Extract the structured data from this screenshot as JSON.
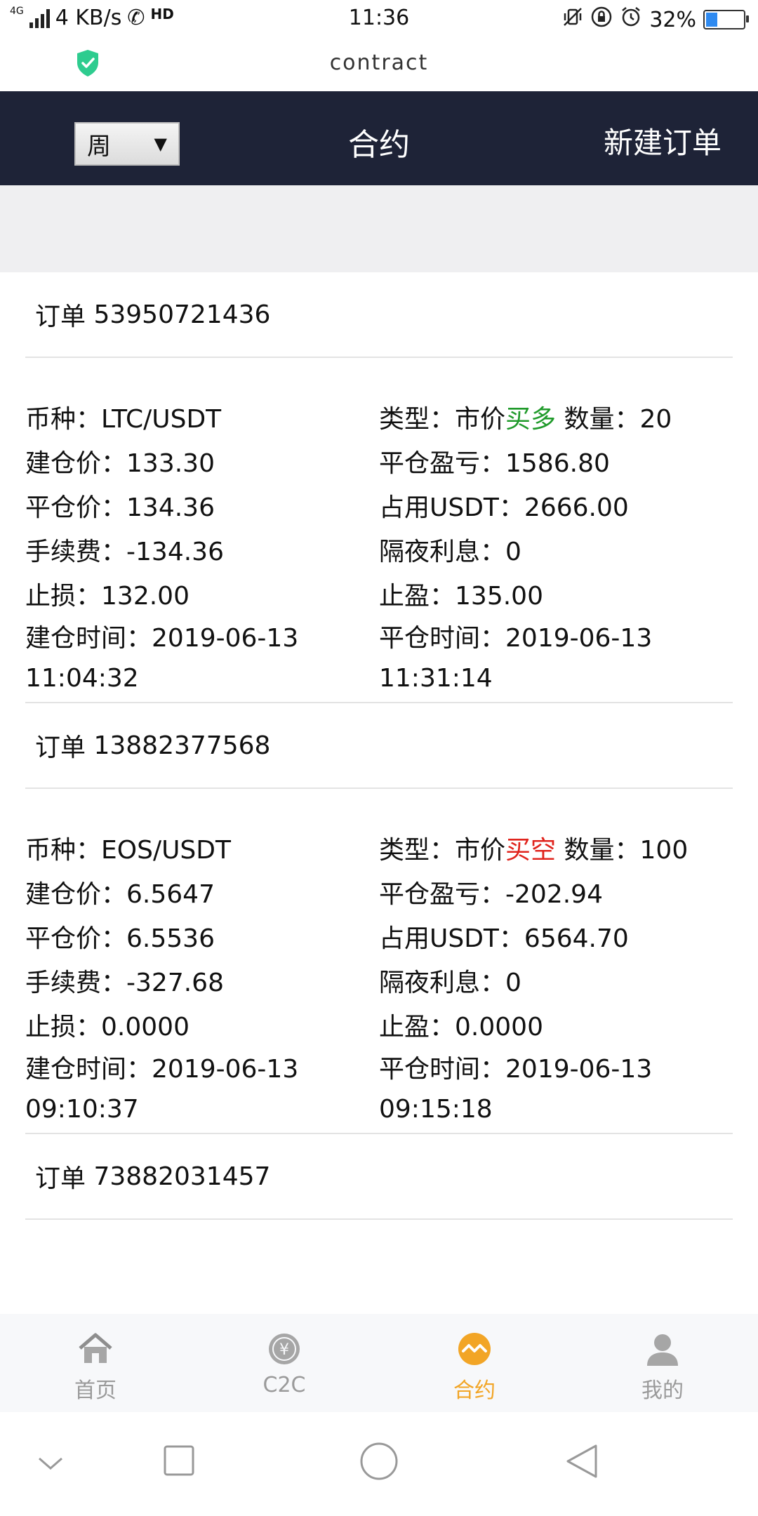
{
  "status": {
    "network": "4G",
    "speed": "4 KB/s",
    "hd": "HD",
    "time": "11:36",
    "battery": "32%",
    "battery_level": 0.32
  },
  "browser": {
    "url": "contract"
  },
  "header": {
    "period": "周",
    "title": "合约",
    "new_order": "新建订单"
  },
  "labels": {
    "order": "订单",
    "symbol": "币种：",
    "type": "类型：",
    "market_price": "市价",
    "quantity": "数量：",
    "open_price": "建仓价：",
    "pnl": "平仓盈亏：",
    "close_price": "平仓价：",
    "margin": "占用USDT：",
    "fee": "手续费：",
    "overnight": "隔夜利息：",
    "stop_loss": "止损：",
    "take_profit": "止盈：",
    "open_time": "建仓时间：",
    "close_time": "平仓时间："
  },
  "orders": [
    {
      "id": "53950721436",
      "symbol": "LTC/USDT",
      "direction": "买多",
      "direction_color": "#1f9a2a",
      "quantity": "20",
      "open_price": "133.30",
      "pnl": "1586.80",
      "close_price": "134.36",
      "margin": "2666.00",
      "fee": "-134.36",
      "overnight": "0",
      "stop_loss": "132.00",
      "take_profit": "135.00",
      "open_time": "2019-06-13 11:04:32",
      "close_time": "2019-06-13 11:31:14"
    },
    {
      "id": "13882377568",
      "symbol": "EOS/USDT",
      "direction": "买空",
      "direction_color": "#e0231c",
      "quantity": "100",
      "open_price": "6.5647",
      "pnl": "-202.94",
      "close_price": "6.5536",
      "margin": "6564.70",
      "fee": "-327.68",
      "overnight": "0",
      "stop_loss": "0.0000",
      "take_profit": "0.0000",
      "open_time": "2019-06-13 09:10:37",
      "close_time": "2019-06-13 09:15:18"
    },
    {
      "id": "73882031457"
    }
  ],
  "nav": {
    "home": "首页",
    "c2c": "C2C",
    "contract": "合约",
    "mine": "我的",
    "active_color": "#f2a526"
  }
}
